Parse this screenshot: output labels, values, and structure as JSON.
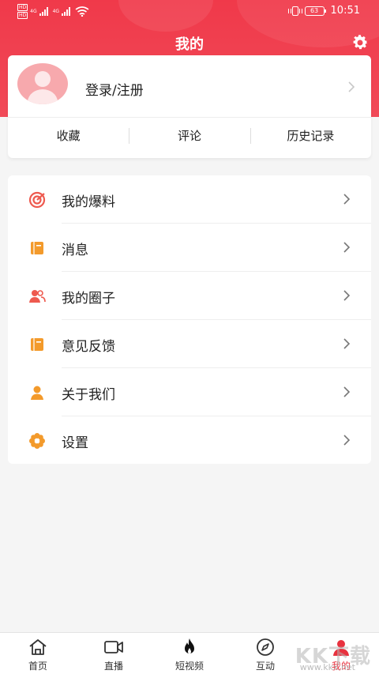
{
  "status_bar": {
    "sim1": "HD",
    "sim2": "HD",
    "net1": "4G",
    "net2": "4G",
    "battery": "63",
    "time": "10:51"
  },
  "header": {
    "title": "我的",
    "settings_icon": "gear-icon"
  },
  "profile": {
    "login_label": "登录/注册",
    "avatar_icon": "user-avatar-icon",
    "tabs": [
      {
        "label": "收藏"
      },
      {
        "label": "评论"
      },
      {
        "label": "历史记录"
      }
    ]
  },
  "menu": {
    "items": [
      {
        "label": "我的爆料",
        "icon": "target-icon"
      },
      {
        "label": "消息",
        "icon": "book-icon"
      },
      {
        "label": "我的圈子",
        "icon": "group-icon"
      },
      {
        "label": "意见反馈",
        "icon": "book-icon"
      },
      {
        "label": "关于我们",
        "icon": "person-icon"
      },
      {
        "label": "设置",
        "icon": "flower-gear-icon"
      }
    ]
  },
  "bottom_nav": {
    "items": [
      {
        "label": "首页",
        "icon": "home-icon"
      },
      {
        "label": "直播",
        "icon": "video-camera-icon"
      },
      {
        "label": "短视频",
        "icon": "flame-icon"
      },
      {
        "label": "互动",
        "icon": "compass-icon"
      },
      {
        "label": "我的",
        "icon": "person-icon",
        "active": true
      }
    ]
  },
  "watermark": {
    "text": "KK下载",
    "url": "www.kkx.net"
  },
  "colors": {
    "brand_red": "#f0394a",
    "icon_orange": "#f39a2b",
    "icon_red": "#ee5a4f",
    "active_nav": "#e8323f"
  }
}
